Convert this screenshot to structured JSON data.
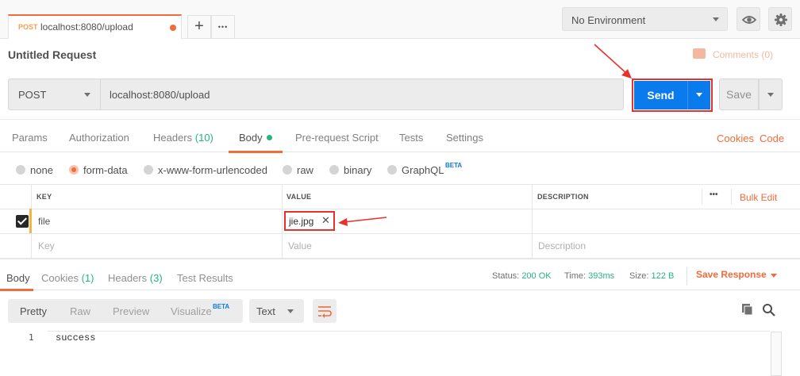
{
  "top_tabs": {
    "request_tab": {
      "method": "POST",
      "url": "localhost:8080/upload"
    },
    "add_label": "+",
    "more_label": "•••"
  },
  "environment": {
    "selected": "No Environment"
  },
  "request": {
    "title": "Untitled Request",
    "comments_label": "Comments (0)",
    "method": "POST",
    "url": "localhost:8080/upload",
    "send_label": "Send",
    "save_label": "Save"
  },
  "request_tabs": {
    "params": "Params",
    "authorization": "Authorization",
    "headers": "Headers",
    "headers_count": "(10)",
    "body": "Body",
    "pre_request": "Pre-request Script",
    "tests": "Tests",
    "settings": "Settings",
    "cookies": "Cookies",
    "code": "Code"
  },
  "body_types": {
    "items": [
      "none",
      "form-data",
      "x-www-form-urlencoded",
      "raw",
      "binary",
      "GraphQL"
    ],
    "selected": "form-data",
    "graphql_badge": "BETA"
  },
  "form_table": {
    "headers": {
      "key": "KEY",
      "value": "VALUE",
      "description": "DESCRIPTION"
    },
    "more_label": "•••",
    "bulk_edit": "Bulk Edit",
    "rows": [
      {
        "checked": true,
        "key": "file",
        "value_file": "jie.jpg",
        "remove": "✕"
      }
    ],
    "placeholders": {
      "key": "Key",
      "value": "Value",
      "description": "Description"
    }
  },
  "response": {
    "tabs": {
      "body": "Body",
      "cookies": "Cookies",
      "cookies_count": "(1)",
      "headers": "Headers",
      "headers_count": "(3)",
      "test_results": "Test Results"
    },
    "status_label": "Status:",
    "status_value": "200 OK",
    "time_label": "Time:",
    "time_value": "393ms",
    "size_label": "Size:",
    "size_value": "122 B",
    "save_response": "Save Response",
    "formats": [
      "Pretty",
      "Raw",
      "Preview",
      "Visualize"
    ],
    "visualize_badge": "BETA",
    "language": "Text",
    "lines": [
      {
        "num": "1",
        "text": "success"
      }
    ]
  },
  "colors": {
    "accent_orange": "#f26b3a",
    "send_blue": "#097bed",
    "status_green": "#26b47f",
    "annotation_red": "#e7312d"
  },
  "icons": [
    "eye-icon",
    "gear-icon",
    "comment-icon",
    "wrap-lines-icon",
    "copy-icon",
    "search-icon",
    "checkbox-icon",
    "caret-down-icon"
  ]
}
